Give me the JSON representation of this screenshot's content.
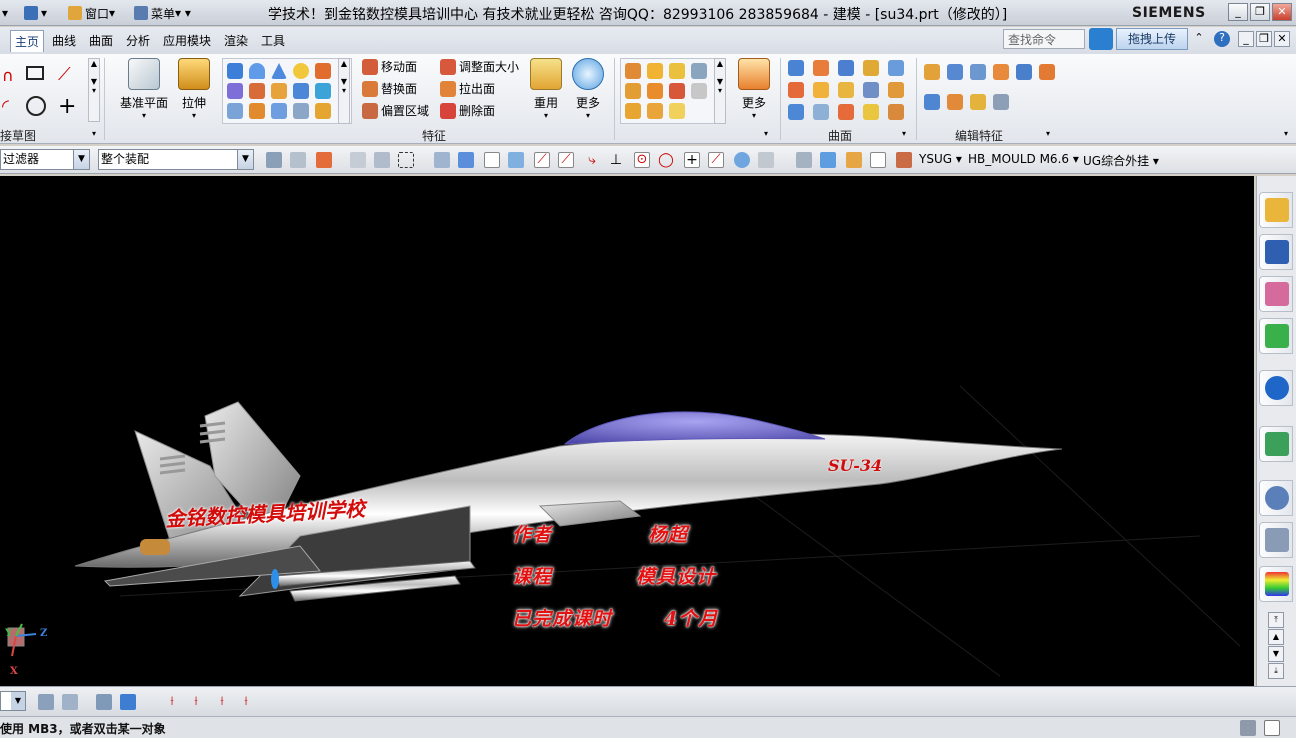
{
  "titlebar": {
    "quick_access": {
      "window_label": "窗口",
      "menu_label": "菜单"
    },
    "title": "学技术！到金铭数控模具培训中心 有技术就业更轻松   咨询QQ：82993106   283859684 - 建模 - [su34.prt（修改的）]",
    "brand": "SIEMENS",
    "window_buttons": [
      "_",
      "❐",
      "✕"
    ]
  },
  "menu": {
    "tabs": [
      "主页",
      "曲线",
      "曲面",
      "分析",
      "应用模块",
      "渲染",
      "工具"
    ],
    "active_tab": "主页",
    "search_placeholder": "查找命令",
    "upload_label": "拖拽上传",
    "help_label": "?"
  },
  "ribbon": {
    "groups": {
      "sketch": "接草图",
      "feature": "特征",
      "surface": "曲面",
      "edit_feature": "编辑特征"
    },
    "datum_plane": "基准平面",
    "extrude": "拉伸",
    "move_face": "移动面",
    "replace_face": "替换面",
    "offset_region": "偏置区域",
    "resize_face": "调整面大小",
    "pull_face": "拉出面",
    "delete_face": "删除面",
    "reuse": "重用",
    "more1": "更多",
    "more2": "更多"
  },
  "selection": {
    "filter_label": "过滤器",
    "scope_label": "整个装配",
    "ysug": "YSUG",
    "hb_mould": "HB_MOULD M6.6",
    "ug_plugin": "UG综合外挂"
  },
  "viewport": {
    "school_name": "金铭数控模具培训学校",
    "aircraft_label": "SU-34",
    "author_label": "作者",
    "author_value": "杨超",
    "course_label": "课程",
    "course_value": "模具设计",
    "duration_label": "已完成课时",
    "duration_value": "4个月",
    "axis_labels": {
      "z": "Z",
      "y": "Y",
      "x": "X"
    }
  },
  "status": {
    "message": "使用 MB3，或者双击某一对象"
  },
  "colors": {
    "viewport_bg": "#000000",
    "overlay_red": "#e31111",
    "canopy": "#7b74d6"
  }
}
